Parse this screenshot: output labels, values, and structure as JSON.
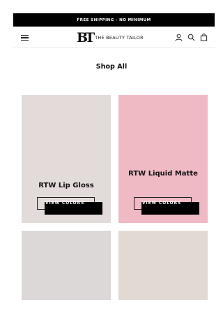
{
  "announcement": "FREE SHIPPING - NO MINIMUM",
  "header": {
    "logo_mark": "BT",
    "logo_text": "THE BEAUTY TAILOR",
    "icons": [
      "menu-icon",
      "account-icon",
      "search-icon",
      "cart-icon"
    ]
  },
  "page": {
    "title": "Shop All"
  },
  "products": [
    {
      "name": "RTW Lip Gloss",
      "button": "VIEW COLORS",
      "color": "#e2dbda"
    },
    {
      "name": "RTW Liquid Matte",
      "button": "VIEW COLORS",
      "color": "#efbac4"
    },
    {
      "color": "#dcd8d7"
    },
    {
      "color": "#e3d9d3"
    }
  ]
}
